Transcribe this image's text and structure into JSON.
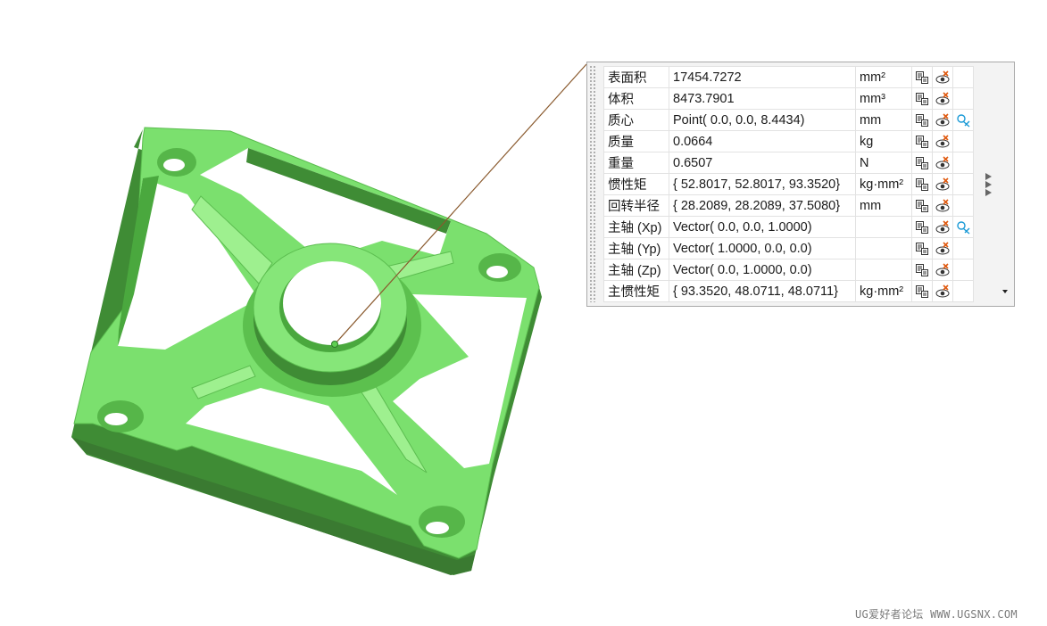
{
  "properties": [
    {
      "name": "表面积",
      "value": "17454.7272",
      "unit": "mm²",
      "has_extra_icon": false
    },
    {
      "name": "体积",
      "value": "8473.7901",
      "unit": "mm³",
      "has_extra_icon": false
    },
    {
      "name": "质心",
      "value": "Point( 0.0, 0.0, 8.4434)",
      "unit": "mm",
      "has_extra_icon": true
    },
    {
      "name": "质量",
      "value": "0.0664",
      "unit": "kg",
      "has_extra_icon": false
    },
    {
      "name": "重量",
      "value": "0.6507",
      "unit": "N",
      "has_extra_icon": false
    },
    {
      "name": "惯性矩",
      "value": "{ 52.8017, 52.8017, 93.3520}",
      "unit": "kg·mm²",
      "has_extra_icon": false
    },
    {
      "name": "回转半径",
      "value": "{ 28.2089, 28.2089, 37.5080}",
      "unit": "mm",
      "has_extra_icon": false
    },
    {
      "name": "主轴 (Xp)",
      "value": "Vector( 0.0, 0.0, 1.0000)",
      "unit": "",
      "has_extra_icon": true
    },
    {
      "name": "主轴 (Yp)",
      "value": "Vector( 1.0000, 0.0, 0.0)",
      "unit": "",
      "has_extra_icon": false
    },
    {
      "name": "主轴 (Zp)",
      "value": "Vector( 0.0, 1.0000, 0.0)",
      "unit": "",
      "has_extra_icon": false
    },
    {
      "name": "主惯性矩",
      "value": "{ 93.3520, 48.0711, 48.0711}",
      "unit": "kg·mm²",
      "has_extra_icon": false
    }
  ],
  "icons": {
    "export": "export-to-expression-icon",
    "visibility": "toggle-visibility-icon",
    "csys": "show-coordinate-icon"
  },
  "watermark": "UG爱好者论坛 WWW.UGSNX.COM",
  "colors": {
    "part_face": "#78e06c",
    "part_side": "#4aa83e",
    "part_dark": "#2e6e28",
    "leader_line": "#8a5a2e"
  }
}
